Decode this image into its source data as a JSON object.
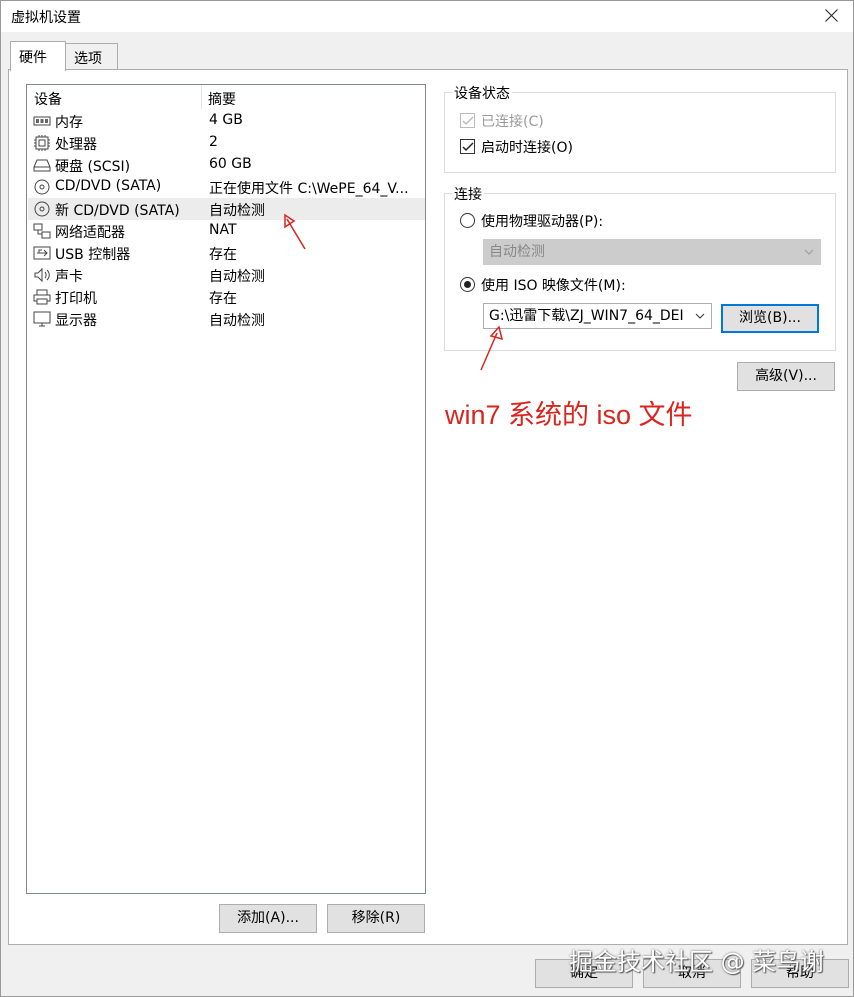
{
  "window": {
    "title": "虚拟机设置"
  },
  "tabs": [
    {
      "label": "硬件",
      "active": true
    },
    {
      "label": "选项",
      "active": false
    }
  ],
  "device_list": {
    "columns": [
      "设备",
      "摘要"
    ],
    "rows": [
      {
        "icon": "memory-icon",
        "name": "内存",
        "summary": "4 GB"
      },
      {
        "icon": "processor-icon",
        "name": "处理器",
        "summary": "2"
      },
      {
        "icon": "hard-disk-icon",
        "name": "硬盘 (SCSI)",
        "summary": "60 GB"
      },
      {
        "icon": "cd-dvd-icon",
        "name": "CD/DVD (SATA)",
        "summary": "正在使用文件 C:\\WePE_64_V..."
      },
      {
        "icon": "cd-dvd-icon",
        "name": "新 CD/DVD (SATA)",
        "summary": "自动检测",
        "selected": true
      },
      {
        "icon": "network-adapter-icon",
        "name": "网络适配器",
        "summary": "NAT"
      },
      {
        "icon": "usb-icon",
        "name": "USB 控制器",
        "summary": "存在"
      },
      {
        "icon": "sound-card-icon",
        "name": "声卡",
        "summary": "自动检测"
      },
      {
        "icon": "printer-icon",
        "name": "打印机",
        "summary": "存在"
      },
      {
        "icon": "display-icon",
        "name": "显示器",
        "summary": "自动检测"
      }
    ]
  },
  "list_buttons": {
    "add": "添加(A)...",
    "remove": "移除(R)"
  },
  "device_status": {
    "title": "设备状态",
    "connected": {
      "label": "已连接(C)",
      "checked": true,
      "disabled": true
    },
    "connect_at_power_on": {
      "label": "启动时连接(O)",
      "checked": true
    }
  },
  "connection": {
    "title": "连接",
    "physical_drive": {
      "label": "使用物理驱动器(P):",
      "selected": false,
      "value": "自动检测"
    },
    "iso_image": {
      "label": "使用 ISO 映像文件(M):",
      "selected": true,
      "value": "G:\\迅雷下载\\ZJ_WIN7_64_DEI"
    },
    "browse_button": "浏览(B)..."
  },
  "advanced_button": "高级(V)...",
  "annotation": "win7 系统的 iso 文件",
  "footer": {
    "ok": "确定",
    "cancel": "取消",
    "help": "帮助"
  },
  "watermark": "掘金技术社区 @ 菜鸟谢",
  "colors": {
    "accent": "#0078d7",
    "annotation": "#d9251d",
    "selected_row": "#ececec"
  }
}
